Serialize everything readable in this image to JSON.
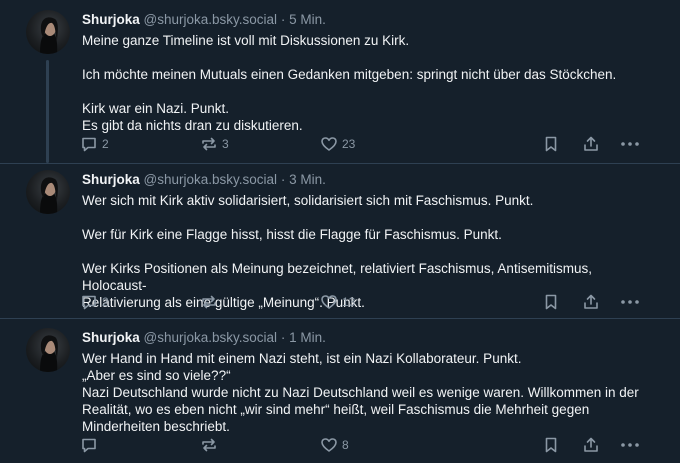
{
  "posts": [
    {
      "author": "Shurjoka",
      "handle": "@shurjoka.bsky.social",
      "separator": "·",
      "time": "5 Min.",
      "lines": [
        "Meine ganze Timeline ist voll mit Diskussionen zu Kirk.",
        "",
        "Ich möchte meinen Mutuals einen Gedanken mitgeben: springt nicht über das Stöckchen.",
        "",
        "Kirk war ein Nazi. Punkt.",
        "Es gibt da nichts dran zu diskutieren."
      ],
      "replies": "2",
      "reposts": "3",
      "likes": "23"
    },
    {
      "author": "Shurjoka",
      "handle": "@shurjoka.bsky.social",
      "separator": "·",
      "time": "3 Min.",
      "lines": [
        "Wer sich mit Kirk aktiv solidarisiert, solidarisiert sich mit Faschismus. Punkt.",
        "",
        "Wer für Kirk eine Flagge hisst, hisst die Flagge für Faschismus. Punkt.",
        "",
        "Wer Kirks Positionen als Meinung bezeichnet, relativiert Faschismus, Antisemitismus, Holocaust-",
        "Relativierung als eine gültige  „Meinung“. Punkt."
      ],
      "replies": "2",
      "reposts": "",
      "likes": "13"
    },
    {
      "author": "Shurjoka",
      "handle": "@shurjoka.bsky.social",
      "separator": "·",
      "time": "1 Min.",
      "lines": [
        "Wer Hand in Hand mit einem Nazi steht, ist ein Nazi Kollaborateur. Punkt.",
        "„Aber es sind so viele??“",
        "Nazi Deutschland wurde nicht zu Nazi Deutschland weil es wenige waren. Willkommen in der",
        "Realität, wo es eben nicht „wir sind mehr“ heißt, weil Faschismus die Mehrheit gegen",
        "Minderheiten beschriebt."
      ],
      "replies": "",
      "reposts": "",
      "likes": "8"
    }
  ],
  "icons": {
    "reply": "speech-bubble-icon",
    "repost": "repost-arrows-icon",
    "like": "heart-icon",
    "bookmark": "bookmark-icon",
    "share": "share-upload-icon",
    "more": "more-dots-icon"
  },
  "colors": {
    "background": "#15202b",
    "text": "#f1f3f5",
    "muted": "#8b98a5",
    "divider": "#2e4052"
  }
}
